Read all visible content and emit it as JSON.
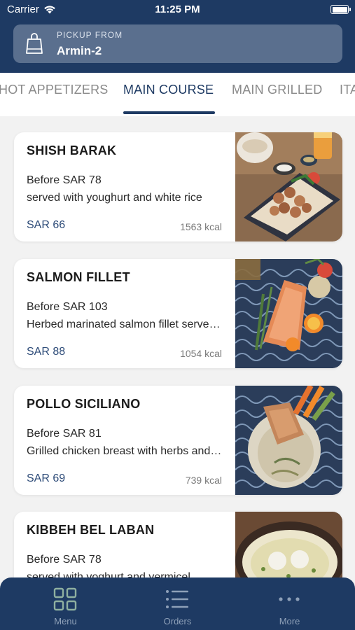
{
  "status_bar": {
    "carrier": "Carrier",
    "time": "11:25 PM"
  },
  "pickup": {
    "label": "PICKUP FROM",
    "value": "Armin-2",
    "icon": "shopping-bag-icon"
  },
  "tabs": [
    {
      "label": "HOT APPETIZERS",
      "active": false
    },
    {
      "label": "MAIN COURSE",
      "active": true
    },
    {
      "label": "MAIN GRILLED",
      "active": false
    },
    {
      "label": "ITA",
      "active": false
    }
  ],
  "menu_items": [
    {
      "name": "SHISH BARAK",
      "before": "Before SAR 78",
      "description": "served with youghurt and white rice",
      "price": "SAR 66",
      "kcal": "1563 kcal"
    },
    {
      "name": "SALMON FILLET",
      "before": "Before SAR 103",
      "description": "Herbed marinated salmon fillet served with rice",
      "price": "SAR 88",
      "kcal": "1054 kcal"
    },
    {
      "name": "POLLO SICILIANO",
      "before": "Before SAR 81",
      "description": "Grilled chicken breast with herbs and cream sauce",
      "price": "SAR 69",
      "kcal": "739 kcal"
    },
    {
      "name": "KIBBEH BEL LABAN",
      "before": "Before SAR 78",
      "description": "served with yoghurt and vermicel",
      "price": "",
      "kcal": ""
    }
  ],
  "bottom_nav": [
    {
      "label": "Menu",
      "icon": "grid-icon",
      "active": true
    },
    {
      "label": "Orders",
      "icon": "list-icon",
      "active": false
    },
    {
      "label": "More",
      "icon": "more-dots-icon",
      "active": false
    }
  ],
  "colors": {
    "primary": "#1e3a63",
    "price": "#2d4b78",
    "pickup_bg": "#5a6f8e",
    "background": "#f2f2f2"
  }
}
